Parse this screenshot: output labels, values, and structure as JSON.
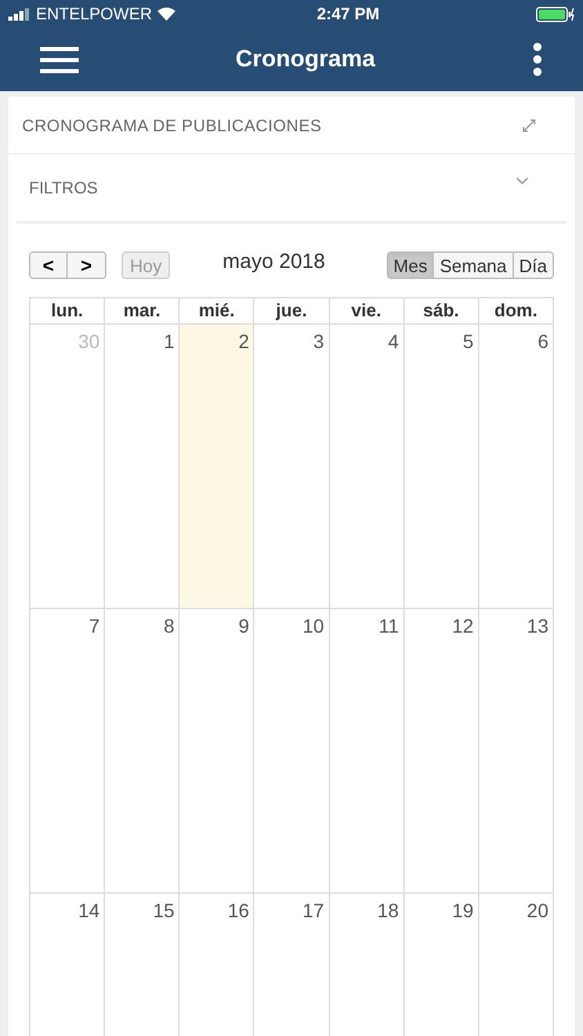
{
  "status_bar": {
    "carrier": "ENTELPOWER",
    "time": "2:47 PM"
  },
  "header": {
    "title": "Cronograma"
  },
  "panel": {
    "title": "CRONOGRAMA DE PUBLICACIONES"
  },
  "filters": {
    "title": "FILTROS",
    "expanded": false
  },
  "toolbar": {
    "prev": "<",
    "next": ">",
    "today": "Hoy",
    "month_title": "mayo 2018",
    "views": [
      {
        "label": "Mes",
        "selected": true
      },
      {
        "label": "Semana",
        "selected": false
      },
      {
        "label": "Día",
        "selected": false
      }
    ]
  },
  "calendar": {
    "weekdays": [
      "lun.",
      "mar.",
      "mié.",
      "jue.",
      "vie.",
      "sáb.",
      "dom."
    ],
    "weeks": [
      [
        {
          "day": "30",
          "outside": true,
          "selected": false
        },
        {
          "day": "1",
          "outside": false,
          "selected": false
        },
        {
          "day": "2",
          "outside": false,
          "selected": true
        },
        {
          "day": "3",
          "outside": false,
          "selected": false
        },
        {
          "day": "4",
          "outside": false,
          "selected": false
        },
        {
          "day": "5",
          "outside": false,
          "selected": false
        },
        {
          "day": "6",
          "outside": false,
          "selected": false
        }
      ],
      [
        {
          "day": "7",
          "outside": false,
          "selected": false
        },
        {
          "day": "8",
          "outside": false,
          "selected": false
        },
        {
          "day": "9",
          "outside": false,
          "selected": false
        },
        {
          "day": "10",
          "outside": false,
          "selected": false
        },
        {
          "day": "11",
          "outside": false,
          "selected": false
        },
        {
          "day": "12",
          "outside": false,
          "selected": false
        },
        {
          "day": "13",
          "outside": false,
          "selected": false
        }
      ],
      [
        {
          "day": "14",
          "outside": false,
          "selected": false
        },
        {
          "day": "15",
          "outside": false,
          "selected": false
        },
        {
          "day": "16",
          "outside": false,
          "selected": false
        },
        {
          "day": "17",
          "outside": false,
          "selected": false
        },
        {
          "day": "18",
          "outside": false,
          "selected": false
        },
        {
          "day": "19",
          "outside": false,
          "selected": false
        },
        {
          "day": "20",
          "outside": false,
          "selected": false
        }
      ]
    ]
  }
}
